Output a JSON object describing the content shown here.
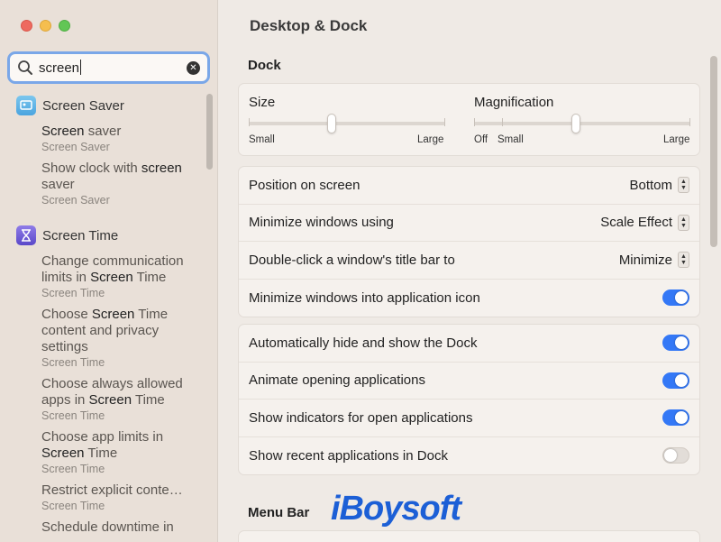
{
  "window": {
    "title": "Desktop & Dock"
  },
  "search": {
    "value": "screen"
  },
  "sidebar": {
    "groups": [
      {
        "title": "Screen Saver",
        "icon": "screen-saver-icon",
        "results": [
          {
            "pre": "",
            "hit": "Screen",
            "post": " saver",
            "sub": "Screen Saver"
          },
          {
            "pre": "Show clock with ",
            "hit": "screen",
            "post": " saver",
            "sub": "Screen Saver"
          }
        ]
      },
      {
        "title": "Screen Time",
        "icon": "hourglass-icon",
        "results": [
          {
            "pre": "Change communication limits in ",
            "hit": "Screen",
            "post": " Time",
            "sub": "Screen Time"
          },
          {
            "pre": "Choose ",
            "hit": "Screen",
            "post": " Time content and privacy settings",
            "sub": "Screen Time"
          },
          {
            "pre": "Choose always allowed apps in ",
            "hit": "Screen",
            "post": " Time",
            "sub": "Screen Time"
          },
          {
            "pre": "Choose app limits in ",
            "hit": "Screen",
            "post": " Time",
            "sub": "Screen Time"
          },
          {
            "pre": "Restrict explicit conte…",
            "hit": "",
            "post": "",
            "sub": "Screen Time"
          },
          {
            "pre": "Schedule downtime in",
            "hit": "",
            "post": "",
            "sub": ""
          }
        ]
      }
    ]
  },
  "dock": {
    "section_title": "Dock",
    "size": {
      "label": "Size",
      "min": "Small",
      "max": "Large",
      "value": 0.42
    },
    "magnification": {
      "label": "Magnification",
      "off": "Off",
      "min": "Small",
      "max": "Large",
      "value": 0.47
    },
    "rows1": [
      {
        "label": "Position on screen",
        "kind": "popup",
        "value": "Bottom"
      },
      {
        "label": "Minimize windows using",
        "kind": "popup",
        "value": "Scale Effect"
      },
      {
        "label": "Double-click a window's title bar to",
        "kind": "popup",
        "value": "Minimize"
      },
      {
        "label": "Minimize windows into application icon",
        "kind": "toggle",
        "on": true
      }
    ],
    "rows2": [
      {
        "label": "Automatically hide and show the Dock",
        "kind": "toggle",
        "on": true
      },
      {
        "label": "Animate opening applications",
        "kind": "toggle",
        "on": true
      },
      {
        "label": "Show indicators for open applications",
        "kind": "toggle",
        "on": true
      },
      {
        "label": "Show recent applications in Dock",
        "kind": "toggle",
        "on": false
      }
    ]
  },
  "menu_bar": {
    "section_title": "Menu Bar"
  },
  "watermark": {
    "text": "iBoysoft"
  },
  "colors": {
    "accent": "#3478f6",
    "search_focus": "#7aa7e8",
    "watermark": "#1c5fd6"
  }
}
